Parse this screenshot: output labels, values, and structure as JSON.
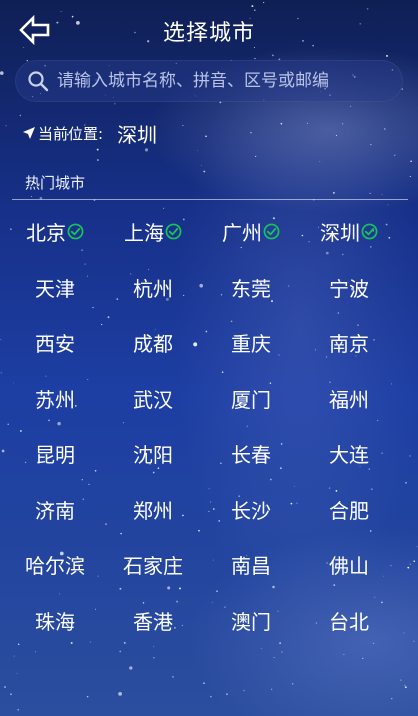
{
  "header": {
    "title": "选择城市",
    "back_icon": "back-arrow-icon"
  },
  "search": {
    "placeholder": "请输入城市名称、拼音、区号或邮编",
    "value": "",
    "icon": "search-icon"
  },
  "location": {
    "label": "当前位置:",
    "city": "深圳",
    "icon": "location-arrow-icon"
  },
  "hot_cities": {
    "label": "热门城市",
    "check_color": "#18c45a",
    "items": [
      {
        "name": "北京",
        "checked": true
      },
      {
        "name": "上海",
        "checked": true
      },
      {
        "name": "广州",
        "checked": true
      },
      {
        "name": "深圳",
        "checked": true
      },
      {
        "name": "天津",
        "checked": false
      },
      {
        "name": "杭州",
        "checked": false
      },
      {
        "name": "东莞",
        "checked": false
      },
      {
        "name": "宁波",
        "checked": false
      },
      {
        "name": "西安",
        "checked": false
      },
      {
        "name": "成都",
        "checked": false
      },
      {
        "name": "重庆",
        "checked": false
      },
      {
        "name": "南京",
        "checked": false
      },
      {
        "name": "苏州",
        "checked": false
      },
      {
        "name": "武汉",
        "checked": false
      },
      {
        "name": "厦门",
        "checked": false
      },
      {
        "name": "福州",
        "checked": false
      },
      {
        "name": "昆明",
        "checked": false
      },
      {
        "name": "沈阳",
        "checked": false
      },
      {
        "name": "长春",
        "checked": false
      },
      {
        "name": "大连",
        "checked": false
      },
      {
        "name": "济南",
        "checked": false
      },
      {
        "name": "郑州",
        "checked": false
      },
      {
        "name": "长沙",
        "checked": false
      },
      {
        "name": "合肥",
        "checked": false
      },
      {
        "name": "哈尔滨",
        "checked": false
      },
      {
        "name": "石家庄",
        "checked": false
      },
      {
        "name": "南昌",
        "checked": false
      },
      {
        "name": "佛山",
        "checked": false
      },
      {
        "name": "珠海",
        "checked": false
      },
      {
        "name": "香港",
        "checked": false
      },
      {
        "name": "澳门",
        "checked": false
      },
      {
        "name": "台北",
        "checked": false
      }
    ]
  }
}
